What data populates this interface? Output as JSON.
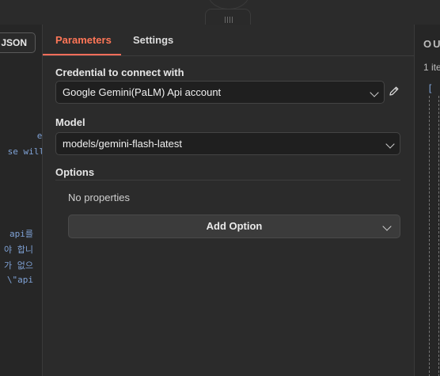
{
  "left_panel": {
    "json_button": "JSON",
    "code_lines": [
      "er",
      "se will",
      "api를",
      "야 합니",
      "가 없으",
      ": \\\"api"
    ]
  },
  "tabs": {
    "parameters": "Parameters",
    "settings": "Settings"
  },
  "credential": {
    "label": "Credential to connect with",
    "value": "Google Gemini(PaLM) Api account"
  },
  "model": {
    "label": "Model",
    "value": "models/gemini-flash-latest"
  },
  "options": {
    "label": "Options",
    "empty_text": "No properties",
    "add_button": "Add Option"
  },
  "output_panel": {
    "title": "OU",
    "items_text": "1 ite",
    "bracket": "["
  },
  "colors": {
    "accent": "#ff6d5a",
    "background": "#2b2b2b",
    "input_bg": "#1f1f1f",
    "code": "#7fa2d6"
  },
  "icons": [
    "pencil-icon",
    "chevron-down-icon",
    "drag-handle-icon"
  ]
}
